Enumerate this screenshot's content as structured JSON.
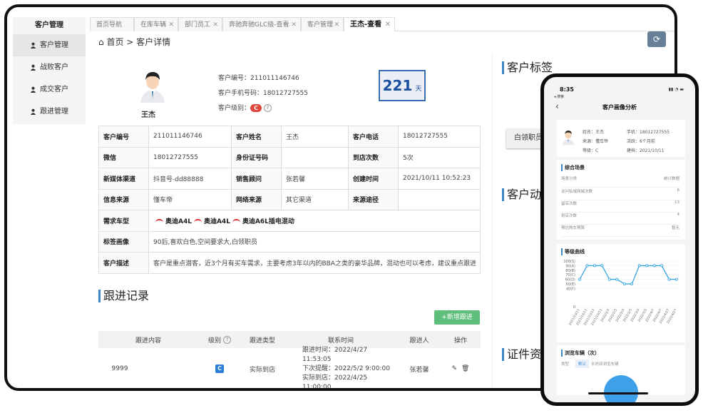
{
  "sidebar": {
    "title": "客户管理",
    "items": [
      {
        "label": "客户管理",
        "active": true
      },
      {
        "label": "战败客户"
      },
      {
        "label": "成交客户"
      },
      {
        "label": "跟进管理"
      }
    ]
  },
  "tabs": [
    {
      "label": "首页导航"
    },
    {
      "label": "在库车辆"
    },
    {
      "label": "部门员工"
    },
    {
      "label": "奔驰奔驰GLC级-查看"
    },
    {
      "label": "客户管理"
    },
    {
      "label": "王杰-查看",
      "active": true
    }
  ],
  "breadcrumb": {
    "home": "首页",
    "sep": ">",
    "current": "客户详情"
  },
  "customer": {
    "name": "王杰",
    "code_label": "客户编号：",
    "code": "211011146746",
    "phone_label": "客户手机号码：",
    "phone": "18012727555",
    "level_label": "客户级别：",
    "level": "C",
    "days": "221",
    "days_unit": "天"
  },
  "info_rows": [
    [
      {
        "h": "客户编号"
      },
      {
        "v": "211011146746"
      },
      {
        "h": "客户姓名"
      },
      {
        "v": "王杰"
      },
      {
        "h": "客户电话"
      },
      {
        "v": "18012727555"
      }
    ],
    [
      {
        "h": "微信"
      },
      {
        "v": "18012727555"
      },
      {
        "h": "身份证号码"
      },
      {
        "v": ""
      },
      {
        "h": "到店次数"
      },
      {
        "v": "5次"
      }
    ],
    [
      {
        "h": "新媒体渠道"
      },
      {
        "v": "抖音号-dd88888"
      },
      {
        "h": "销售顾问"
      },
      {
        "v": "张若馨"
      },
      {
        "h": "创建时间"
      },
      {
        "v": "2021/10/11 10:52:23"
      }
    ],
    [
      {
        "h": "信息来源"
      },
      {
        "v": "懂车帝"
      },
      {
        "h": "网络来源"
      },
      {
        "v": "其它渠道"
      },
      {
        "h": "来源途径"
      },
      {
        "v": ""
      }
    ]
  ],
  "demand": {
    "label": "需求车型",
    "cars": [
      "奥迪A4L",
      "奥迪A4L",
      "奥迪A6L插电混动"
    ]
  },
  "tag_row": {
    "label": "标签画像",
    "value": "90后,喜欢白色,空间要求大,白领职员"
  },
  "desc_row": {
    "label": "客户描述",
    "value": "客户是重点潜客，近3个月有买车需求，主要考虑3年以内的BBA之类的豪华品牌，混动也可以考虑，建议重点跟进"
  },
  "followup": {
    "title": "跟进记录",
    "add_label": "+新增跟进",
    "headers": [
      "跟进内容",
      "级别",
      "跟进类型",
      "联系时间",
      "跟进人",
      "操作"
    ],
    "row": {
      "content": "9999",
      "level": "C",
      "type": "实际到店",
      "times": [
        "跟进时间：2022/4/27 11:53:05",
        "下次提醒：2022/5/2 9:00:00",
        "实际到店：2022/4/25 11:00:00"
      ],
      "person": "张若馨"
    }
  },
  "right": {
    "tags_title": "客户标签",
    "tag": "白领职员",
    "dynamics_title": "客户动态",
    "docs_title": "证件资料"
  },
  "phone": {
    "time": "8:35",
    "back_sub": "◂ 搜索",
    "title": "客户画像分析",
    "profile": [
      [
        "姓名：",
        "王杰"
      ],
      [
        "手机：",
        "18012727555"
      ],
      [
        "来源：",
        "懂车帝"
      ],
      [
        "活跃：",
        "6个月前"
      ],
      [
        "等级：",
        "C"
      ],
      [
        "建档：",
        "2021/10/11"
      ]
    ],
    "scene_title": "综合场景",
    "scene_head": [
      "场景分类",
      "统计数据"
    ],
    "scene_rows": [
      [
        "访问私域商城次数",
        "6"
      ],
      [
        "留店次数",
        "13"
      ],
      [
        "到店次数",
        "4"
      ],
      [
        "预估购车预算",
        "暂无"
      ]
    ],
    "curve_title": "等级曲线",
    "browse_title": "浏览车辆（次）",
    "browse_type": "类型",
    "browse_tabs": [
      "默认",
      "长时间浏览车辆"
    ]
  },
  "chart_data": {
    "type": "line",
    "title": "等级曲线",
    "x": [
      "2021/10/11",
      "2021/10/11",
      "2021/10/11",
      "2021/10/11",
      "2022/2/3",
      "2022/2/3",
      "2022/2/3",
      "2022/2/3",
      "2022/3/3",
      "2022/3/3",
      "2022/4/7",
      "2022/4/7",
      "2022/4/27",
      "2022/4/27"
    ],
    "values": [
      60,
      90,
      90,
      90,
      60,
      60,
      50,
      50,
      90,
      90,
      90,
      90,
      60,
      60
    ],
    "ylim": [
      0,
      100
    ],
    "yticks": [
      "0",
      "40(F)",
      "50(E)",
      "60(D)",
      "70(C)",
      "80(B)",
      "90(A)",
      "100(S)"
    ],
    "color": "#29a0e0"
  }
}
